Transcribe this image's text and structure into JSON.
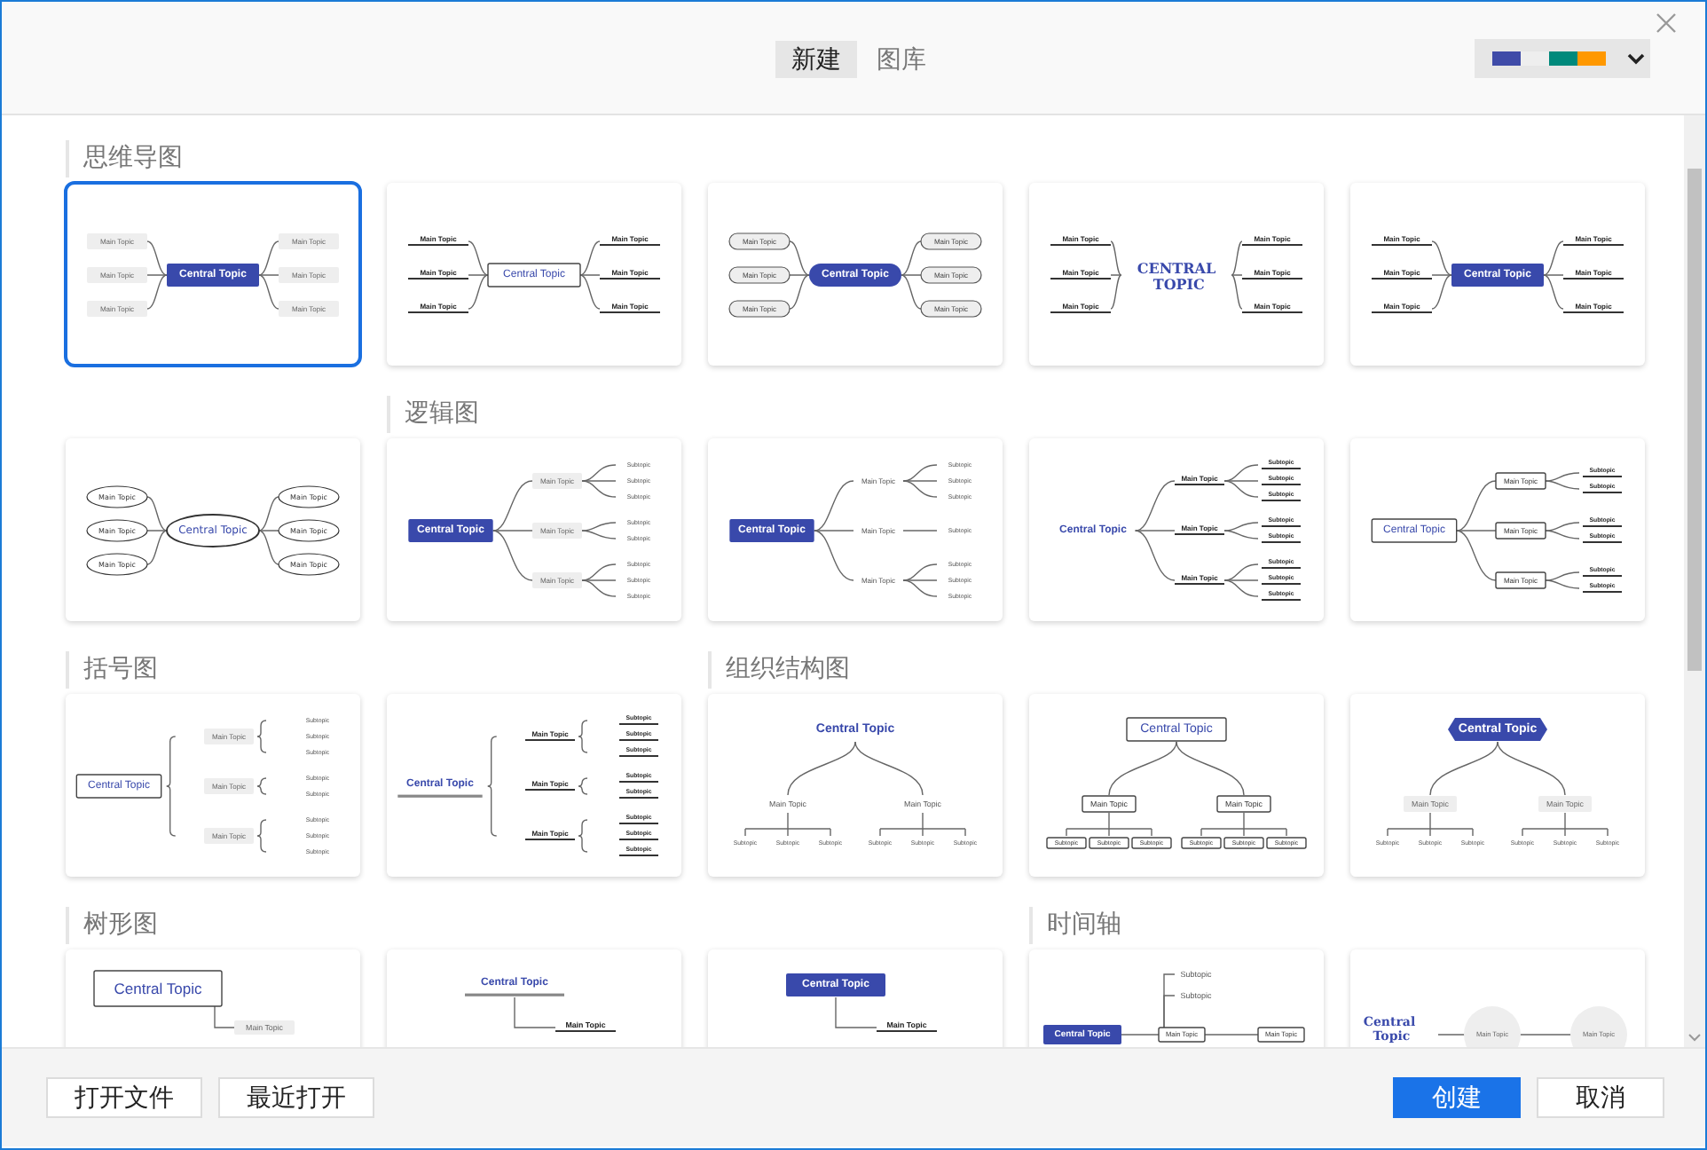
{
  "tabs": [
    {
      "label": "新建",
      "selected": true
    },
    {
      "label": "图库",
      "selected": false
    }
  ],
  "sections": [
    {
      "title": "思维导图",
      "templates": [
        {
          "kind": "mindmap",
          "selected": true,
          "central": {
            "text": "Central Topic",
            "kind": "filled"
          },
          "topics": [
            {
              "text": "Main Topic",
              "kind": "box"
            },
            {
              "text": "Main Topic",
              "kind": "box"
            },
            {
              "text": "Main Topic",
              "kind": "box"
            },
            {
              "text": "Main Topic",
              "kind": "box"
            },
            {
              "text": "Main Topic",
              "kind": "box"
            },
            {
              "text": "Main Topic",
              "kind": "box"
            }
          ]
        },
        {
          "kind": "mindmap",
          "selected": false,
          "central": {
            "text": "Central Topic",
            "kind": "outline"
          },
          "topics": [
            {
              "text": "Main Topic",
              "kind": "line"
            },
            {
              "text": "Main Topic",
              "kind": "line"
            },
            {
              "text": "Main Topic",
              "kind": "line"
            },
            {
              "text": "Main Topic",
              "kind": "line"
            },
            {
              "text": "Main Topic",
              "kind": "line"
            },
            {
              "text": "Main Topic",
              "kind": "line"
            }
          ]
        },
        {
          "kind": "mindmap",
          "selected": false,
          "central": {
            "text": "Central Topic",
            "kind": "pill"
          },
          "topics": [
            {
              "text": "Main Topic",
              "kind": "roundbox"
            },
            {
              "text": "Main Topic",
              "kind": "roundbox"
            },
            {
              "text": "Main Topic",
              "kind": "roundbox"
            },
            {
              "text": "Main Topic",
              "kind": "roundbox"
            },
            {
              "text": "Main Topic",
              "kind": "roundbox"
            },
            {
              "text": "Main Topic",
              "kind": "roundbox"
            }
          ]
        },
        {
          "kind": "mindmap",
          "selected": false,
          "central": {
            "text": "CENTRAL TOPIC",
            "kind": "stacked"
          },
          "topics": [
            {
              "text": "Main Topic",
              "kind": "line"
            },
            {
              "text": "Main Topic",
              "kind": "line"
            },
            {
              "text": "Main Topic",
              "kind": "line"
            },
            {
              "text": "Main Topic",
              "kind": "line"
            },
            {
              "text": "Main Topic",
              "kind": "line"
            },
            {
              "text": "Main Topic",
              "kind": "line"
            }
          ]
        },
        {
          "kind": "mindmap",
          "selected": false,
          "central": {
            "text": "Central Topic",
            "kind": "filled"
          },
          "topics": [
            {
              "text": "Main Topic",
              "kind": "line"
            },
            {
              "text": "Main Topic",
              "kind": "line"
            },
            {
              "text": "Main Topic",
              "kind": "line"
            },
            {
              "text": "Main Topic",
              "kind": "line"
            },
            {
              "text": "Main Topic",
              "kind": "line"
            },
            {
              "text": "Main Topic",
              "kind": "line"
            }
          ]
        },
        {
          "kind": "mindmap",
          "selected": false,
          "central": {
            "text": "Central Topic",
            "kind": "ellipse"
          },
          "topics": [
            {
              "text": "Main Topic",
              "kind": "ellipse"
            },
            {
              "text": "Main Topic",
              "kind": "ellipse"
            },
            {
              "text": "Main Topic",
              "kind": "ellipse"
            },
            {
              "text": "Main Topic",
              "kind": "ellipse"
            },
            {
              "text": "Main Topic",
              "kind": "ellipse"
            },
            {
              "text": "Main Topic",
              "kind": "ellipse"
            }
          ]
        }
      ]
    },
    {
      "title": "逻辑图",
      "templates": [
        {
          "kind": "logic",
          "selected": false,
          "central": {
            "text": "Central Topic",
            "kind": "filled"
          },
          "topics": [
            {
              "text": "Main Topic",
              "kind": "box",
              "subtopics": [
                {
                  "text": "Subtopic",
                  "kind": "plain"
                },
                {
                  "text": "Subtopic",
                  "kind": "plain"
                },
                {
                  "text": "Subtopic",
                  "kind": "plain"
                }
              ]
            },
            {
              "text": "Main Topic",
              "kind": "box",
              "subtopics": [
                {
                  "text": "Subtopic",
                  "kind": "plain"
                },
                {
                  "text": "Subtopic",
                  "kind": "plain"
                }
              ]
            },
            {
              "text": "Main Topic",
              "kind": "box",
              "subtopics": [
                {
                  "text": "Subtopic",
                  "kind": "plain"
                },
                {
                  "text": "Subtopic",
                  "kind": "plain"
                },
                {
                  "text": "Subtopic",
                  "kind": "plain"
                }
              ]
            }
          ]
        },
        {
          "kind": "logic",
          "selected": false,
          "central": {
            "text": "Central Topic",
            "kind": "filled"
          },
          "topics": [
            {
              "text": "Main Topic",
              "kind": "plain",
              "subtopics": [
                {
                  "text": "Subtopic",
                  "kind": "plain"
                },
                {
                  "text": "Subtopic",
                  "kind": "plain"
                },
                {
                  "text": "Subtopic",
                  "kind": "plain"
                }
              ]
            },
            {
              "text": "Main Topic",
              "kind": "plain",
              "subtopics": [
                {
                  "text": "Subtopic",
                  "kind": "plain"
                }
              ]
            },
            {
              "text": "Main Topic",
              "kind": "plain",
              "subtopics": [
                {
                  "text": "Subtopic",
                  "kind": "plain"
                },
                {
                  "text": "Subtopic",
                  "kind": "plain"
                },
                {
                  "text": "Subtopic",
                  "kind": "plain"
                }
              ]
            }
          ]
        },
        {
          "kind": "logic",
          "selected": false,
          "central": {
            "text": "Central Topic",
            "kind": "plain"
          },
          "topics": [
            {
              "text": "Main Topic",
              "kind": "line",
              "subtopics": [
                {
                  "text": "Subtopic",
                  "kind": "line"
                },
                {
                  "text": "Subtopic",
                  "kind": "line"
                },
                {
                  "text": "Subtopic",
                  "kind": "line"
                }
              ]
            },
            {
              "text": "Main Topic",
              "kind": "line",
              "subtopics": [
                {
                  "text": "Subtopic",
                  "kind": "line"
                },
                {
                  "text": "Subtopic",
                  "kind": "line"
                }
              ]
            },
            {
              "text": "Main Topic",
              "kind": "line",
              "subtopics": [
                {
                  "text": "Subtopic",
                  "kind": "line"
                },
                {
                  "text": "Subtopic",
                  "kind": "line"
                },
                {
                  "text": "Subtopic",
                  "kind": "line"
                }
              ]
            }
          ]
        },
        {
          "kind": "logic",
          "selected": false,
          "central": {
            "text": "Central Topic",
            "kind": "outline"
          },
          "topics": [
            {
              "text": "Main Topic",
              "kind": "outline",
              "subtopics": [
                {
                  "text": "Subtopic",
                  "kind": "line"
                },
                {
                  "text": "Subtopic",
                  "kind": "line"
                }
              ]
            },
            {
              "text": "Main Topic",
              "kind": "outline",
              "subtopics": [
                {
                  "text": "Subtopic",
                  "kind": "line"
                },
                {
                  "text": "Subtopic",
                  "kind": "line"
                }
              ]
            },
            {
              "text": "Main Topic",
              "kind": "outline",
              "subtopics": [
                {
                  "text": "Subtopic",
                  "kind": "line"
                },
                {
                  "text": "Subtopic",
                  "kind": "line"
                }
              ]
            }
          ]
        }
      ]
    },
    {
      "title": "括号图",
      "templates": [
        {
          "kind": "bracket",
          "selected": false,
          "central": {
            "text": "Central Topic",
            "kind": "outline"
          },
          "topics": [
            {
              "text": "Main Topic",
              "kind": "box",
              "subtopics": [
                {
                  "text": "Subtopic",
                  "kind": "plain"
                },
                {
                  "text": "Subtopic",
                  "kind": "plain"
                },
                {
                  "text": "Subtopic",
                  "kind": "plain"
                }
              ]
            },
            {
              "text": "Main Topic",
              "kind": "box",
              "subtopics": [
                {
                  "text": "Subtopic",
                  "kind": "plain"
                },
                {
                  "text": "Subtopic",
                  "kind": "plain"
                }
              ]
            },
            {
              "text": "Main Topic",
              "kind": "box",
              "subtopics": [
                {
                  "text": "Subtopic",
                  "kind": "plain"
                },
                {
                  "text": "Subtopic",
                  "kind": "plain"
                },
                {
                  "text": "Subtopic",
                  "kind": "plain"
                }
              ]
            }
          ]
        },
        {
          "kind": "bracket",
          "selected": false,
          "central": {
            "text": "Central Topic",
            "kind": "underline"
          },
          "topics": [
            {
              "text": "Main Topic",
              "kind": "line",
              "subtopics": [
                {
                  "text": "Subtopic",
                  "kind": "line"
                },
                {
                  "text": "Subtopic",
                  "kind": "line"
                },
                {
                  "text": "Subtopic",
                  "kind": "line"
                }
              ]
            },
            {
              "text": "Main Topic",
              "kind": "line",
              "subtopics": [
                {
                  "text": "Subtopic",
                  "kind": "line"
                },
                {
                  "text": "Subtopic",
                  "kind": "line"
                }
              ]
            },
            {
              "text": "Main Topic",
              "kind": "line",
              "subtopics": [
                {
                  "text": "Subtopic",
                  "kind": "line"
                },
                {
                  "text": "Subtopic",
                  "kind": "line"
                },
                {
                  "text": "Subtopic",
                  "kind": "line"
                }
              ]
            }
          ]
        }
      ]
    },
    {
      "title": "组织结构图",
      "templates": [
        {
          "kind": "org",
          "selected": false,
          "central": {
            "text": "Central Topic",
            "kind": "plain"
          },
          "topics": [
            {
              "text": "Main Topic",
              "kind": "plain",
              "subtopics": [
                {
                  "text": "Subtopic",
                  "kind": "plain"
                },
                {
                  "text": "Subtopic",
                  "kind": "plain"
                },
                {
                  "text": "Subtopic",
                  "kind": "plain"
                }
              ]
            },
            {
              "text": "Main Topic",
              "kind": "plain",
              "subtopics": [
                {
                  "text": "Subtopic",
                  "kind": "plain"
                },
                {
                  "text": "Subtopic",
                  "kind": "plain"
                },
                {
                  "text": "Subtopic",
                  "kind": "plain"
                }
              ]
            }
          ]
        },
        {
          "kind": "org",
          "selected": false,
          "central": {
            "text": "Central Topic",
            "kind": "outline"
          },
          "topics": [
            {
              "text": "Main Topic",
              "kind": "outline",
              "subtopics": [
                {
                  "text": "Subtopic",
                  "kind": "outline"
                },
                {
                  "text": "Subtopic",
                  "kind": "outline"
                },
                {
                  "text": "Subtopic",
                  "kind": "outline"
                }
              ]
            },
            {
              "text": "Main Topic",
              "kind": "outline",
              "subtopics": [
                {
                  "text": "Subtopic",
                  "kind": "outline"
                },
                {
                  "text": "Subtopic",
                  "kind": "outline"
                },
                {
                  "text": "Subtopic",
                  "kind": "outline"
                }
              ]
            }
          ]
        },
        {
          "kind": "org",
          "selected": false,
          "central": {
            "text": "Central Topic",
            "kind": "hexagon"
          },
          "topics": [
            {
              "text": "Main Topic",
              "kind": "box",
              "subtopics": [
                {
                  "text": "Subtopic",
                  "kind": "plain"
                },
                {
                  "text": "Subtopic",
                  "kind": "plain"
                },
                {
                  "text": "Subtopic",
                  "kind": "plain"
                }
              ]
            },
            {
              "text": "Main Topic",
              "kind": "box",
              "subtopics": [
                {
                  "text": "Subtopic",
                  "kind": "plain"
                },
                {
                  "text": "Subtopic",
                  "kind": "plain"
                },
                {
                  "text": "Subtopic",
                  "kind": "plain"
                }
              ]
            }
          ]
        }
      ]
    },
    {
      "title": "树形图",
      "templates": [
        {
          "kind": "tree",
          "selected": false,
          "central": {
            "text": "Central Topic",
            "kind": "outline"
          },
          "topics": [
            {
              "text": "Main Topic",
              "kind": "box"
            }
          ]
        },
        {
          "kind": "tree",
          "selected": false,
          "central": {
            "text": "Central Topic",
            "kind": "underline"
          },
          "topics": [
            {
              "text": "Main Topic",
              "kind": "line"
            }
          ]
        },
        {
          "kind": "tree",
          "selected": false,
          "central": {
            "text": "Central Topic",
            "kind": "filled"
          },
          "topics": [
            {
              "text": "Main Topic",
              "kind": "line"
            }
          ]
        }
      ]
    },
    {
      "title": "时间轴",
      "templates": [
        {
          "kind": "timeline",
          "selected": false,
          "central": {
            "text": "Central Topic",
            "kind": "filled"
          },
          "topics": [
            {
              "text": "Main Topic",
              "kind": "outline",
              "subtopics": [
                {
                  "text": "Subtopic",
                  "kind": "plain"
                },
                {
                  "text": "Subtopic",
                  "kind": "plain"
                }
              ]
            },
            {
              "text": "Main Topic",
              "kind": "outline"
            }
          ]
        },
        {
          "kind": "timeline",
          "selected": false,
          "central": {
            "text": "Central Topic",
            "kind": "stacked"
          },
          "topics": [
            {
              "text": "Main Topic",
              "kind": "circle"
            },
            {
              "text": "Main Topic",
              "kind": "circle"
            }
          ]
        }
      ]
    }
  ],
  "footer": {
    "left_buttons": [
      "打开文件",
      "最近打开"
    ],
    "primary_button": "创建",
    "cancel_button": "取消"
  }
}
